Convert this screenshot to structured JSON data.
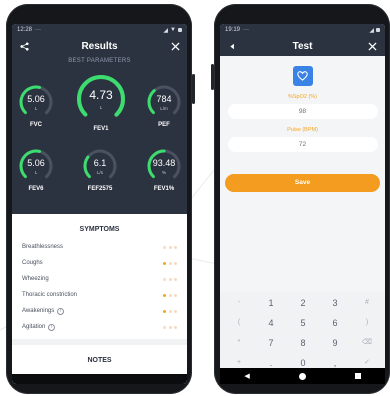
{
  "left_phone": {
    "status_time": "12:28",
    "status_extra": "···",
    "header": {
      "title": "Results"
    },
    "subtitle": "BEST PARAMETERS",
    "gauges": [
      {
        "value": "5.06",
        "unit": "L",
        "label": "FVC",
        "fill": 0.55
      },
      {
        "value": "4.73",
        "unit": "L",
        "label": "FEV1",
        "fill": 1.0
      },
      {
        "value": "784",
        "unit": "L/m",
        "label": "PEF",
        "fill": 0.35
      },
      {
        "value": "5.06",
        "unit": "L",
        "label": "FEV6",
        "fill": 0.55
      },
      {
        "value": "6.1",
        "unit": "L/s",
        "label": "FEF2575",
        "fill": 0.3
      },
      {
        "value": "93.48",
        "unit": "%",
        "label": "FEV1%",
        "fill": 0.5
      }
    ],
    "symptoms_title": "SYMPTOMS",
    "symptoms": [
      {
        "label": "Breathlessness",
        "level": 0,
        "info": false
      },
      {
        "label": "Coughs",
        "level": 1,
        "info": false
      },
      {
        "label": "Wheezing",
        "level": 0,
        "info": false
      },
      {
        "label": "Thoracic constriction",
        "level": 1,
        "info": false
      },
      {
        "label": "Awakenings",
        "level": 1,
        "info": true
      },
      {
        "label": "Agitation",
        "level": 0,
        "info": true
      }
    ],
    "notes_title": "NOTES"
  },
  "right_phone": {
    "status_time": "19:19",
    "status_extra": "···",
    "header": {
      "title": "Test"
    },
    "spo2_label": "%SpO2 (%)",
    "spo2_value": "98",
    "pulse_label": "Pulse (BPM)",
    "pulse_value": "72",
    "save_label": "Save",
    "keypad": {
      "rows": [
        [
          "-",
          "1",
          "2",
          "3",
          "#"
        ],
        [
          "(",
          "4",
          "5",
          "6",
          ")"
        ],
        [
          "*",
          "7",
          "8",
          "9",
          "⌫"
        ],
        [
          "+",
          ".",
          "0",
          ",",
          "✓"
        ]
      ]
    }
  },
  "colors": {
    "dark_bg": "#2c3340",
    "accent_green": "#3ddc6f",
    "accent_orange": "#f5a623",
    "heart_blue": "#3b82e6"
  }
}
